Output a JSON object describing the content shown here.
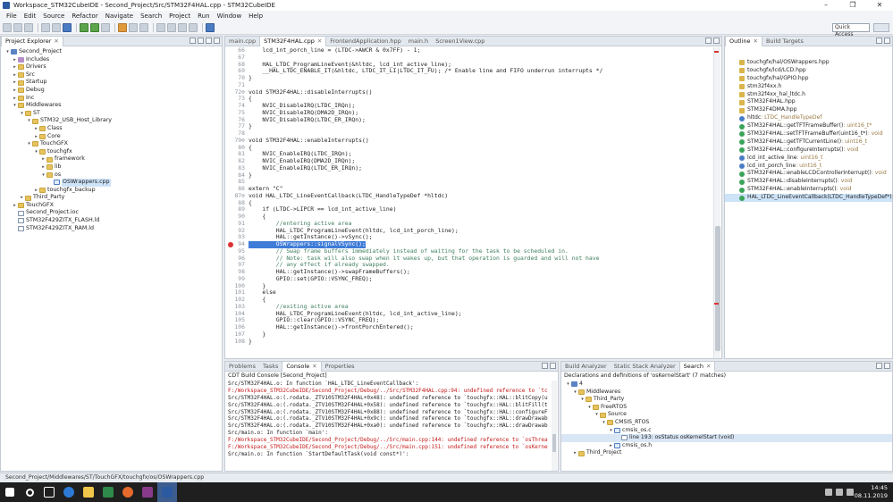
{
  "window": {
    "title": "Workspace_STM32CubeIDE - Second_Project/Src/STM32F4HAL.cpp - STM32CubeIDE",
    "controls": [
      "–",
      "❐",
      "✕"
    ]
  },
  "menu": [
    "File",
    "Edit",
    "Source",
    "Refactor",
    "Navigate",
    "Search",
    "Project",
    "Run",
    "Window",
    "Help"
  ],
  "toolbar": {
    "quick_access": "Quick Access"
  },
  "project_explorer": {
    "tab_label": "Project Explorer",
    "items": [
      {
        "label": "Second_Project",
        "depth": 0,
        "arrow": "▾",
        "icon": "proj"
      },
      {
        "label": "Includes",
        "depth": 1,
        "arrow": "▸",
        "icon": "lib"
      },
      {
        "label": "Drivers",
        "depth": 1,
        "arrow": "▸",
        "icon": "folder"
      },
      {
        "label": "Src",
        "depth": 1,
        "arrow": "▸",
        "icon": "folder"
      },
      {
        "label": "Startup",
        "depth": 1,
        "arrow": "▸",
        "icon": "folder"
      },
      {
        "label": "Debug",
        "depth": 1,
        "arrow": "▸",
        "icon": "folder"
      },
      {
        "label": "Inc",
        "depth": 1,
        "arrow": "▸",
        "icon": "folder"
      },
      {
        "label": "Middlewares",
        "depth": 1,
        "arrow": "▾",
        "icon": "folder"
      },
      {
        "label": "ST",
        "depth": 2,
        "arrow": "▾",
        "icon": "folder"
      },
      {
        "label": "STM32_USB_Host_Library",
        "depth": 3,
        "arrow": "▾",
        "icon": "folder"
      },
      {
        "label": "Class",
        "depth": 4,
        "arrow": "▸",
        "icon": "folder"
      },
      {
        "label": "Core",
        "depth": 4,
        "arrow": "▸",
        "icon": "folder"
      },
      {
        "label": "TouchGFX",
        "depth": 3,
        "arrow": "▾",
        "icon": "folder"
      },
      {
        "label": "touchgfx",
        "depth": 4,
        "arrow": "▾",
        "icon": "folder"
      },
      {
        "label": "framework",
        "depth": 5,
        "arrow": "▸",
        "icon": "folder"
      },
      {
        "label": "lib",
        "depth": 5,
        "arrow": "▸",
        "icon": "folder"
      },
      {
        "label": "os",
        "depth": 5,
        "arrow": "▾",
        "icon": "folder"
      },
      {
        "label": "OSWrappers.cpp",
        "depth": 6,
        "arrow": "",
        "icon": "cfile",
        "selected": true
      },
      {
        "label": "touchgfx_backup",
        "depth": 4,
        "arrow": "▸",
        "icon": "folder"
      },
      {
        "label": "Third_Party",
        "depth": 2,
        "arrow": "▸",
        "icon": "folder"
      },
      {
        "label": "TouchGFX",
        "depth": 1,
        "arrow": "▸",
        "icon": "folder"
      },
      {
        "label": "Second_Project.ioc",
        "depth": 1,
        "arrow": "",
        "icon": "file"
      },
      {
        "label": "STM32F429ZITX_FLASH.ld",
        "depth": 1,
        "arrow": "",
        "icon": "file"
      },
      {
        "label": "STM32F429ZITX_RAM.ld",
        "depth": 1,
        "arrow": "",
        "icon": "file"
      }
    ]
  },
  "editor": {
    "tabs": [
      {
        "label": "main.cpp",
        "active": false
      },
      {
        "label": "STM32F4HAL.cpp",
        "active": true
      },
      {
        "label": "FrontendApplication.hpp",
        "active": false
      },
      {
        "label": "main.h",
        "active": false
      },
      {
        "label": "Screen1View.cpp",
        "active": false
      }
    ],
    "lines": [
      {
        "n": "66",
        "t": "    lcd_int_porch_line = (LTDC->AWCR & 0x7FF) - 1;"
      },
      {
        "n": "67",
        "t": ""
      },
      {
        "n": "68",
        "t": "    HAL_LTDC_ProgramLineEvent(&hltdc, lcd_int_active_line);"
      },
      {
        "n": "69",
        "t": "    __HAL_LTDC_ENABLE_IT(&hltdc, LTDC_IT_LI|LTDC_IT_FU); /* Enable line and FIFO underrun interrupts */"
      },
      {
        "n": "70",
        "t": "}"
      },
      {
        "n": "71",
        "t": ""
      },
      {
        "n": "72⊖",
        "t": "void STM32F4HAL::disableInterrupts()"
      },
      {
        "n": "73",
        "t": "{"
      },
      {
        "n": "74",
        "t": "    NVIC_DisableIRQ(LTDC_IRQn);"
      },
      {
        "n": "75",
        "t": "    NVIC_DisableIRQ(DMA2D_IRQn);"
      },
      {
        "n": "76",
        "t": "    NVIC_DisableIRQ(LTDC_ER_IRQn);"
      },
      {
        "n": "77",
        "t": "}"
      },
      {
        "n": "78",
        "t": ""
      },
      {
        "n": "79⊖",
        "t": "void STM32F4HAL::enableInterrupts()"
      },
      {
        "n": "80",
        "t": "{"
      },
      {
        "n": "81",
        "t": "    NVIC_EnableIRQ(LTDC_IRQn);"
      },
      {
        "n": "82",
        "t": "    NVIC_EnableIRQ(DMA2D_IRQn);"
      },
      {
        "n": "83",
        "t": "    NVIC_EnableIRQ(LTDC_ER_IRQn);"
      },
      {
        "n": "84",
        "t": "}"
      },
      {
        "n": "85",
        "t": ""
      },
      {
        "n": "86",
        "t": "extern \"C\""
      },
      {
        "n": "87⊖",
        "t": "void HAL_LTDC_LineEventCallback(LTDC_HandleTypeDef *hltdc)"
      },
      {
        "n": "88",
        "t": "{"
      },
      {
        "n": "89",
        "t": "    if (LTDC->LIPCR == lcd_int_active_line)"
      },
      {
        "n": "90",
        "t": "    {"
      },
      {
        "n": "91",
        "t": "        //entering active area"
      },
      {
        "n": "92",
        "t": "        HAL_LTDC_ProgramLineEvent(hltdc, lcd_int_porch_line);"
      },
      {
        "n": "93",
        "t": "        HAL::getInstance()->vSync();"
      },
      {
        "n": "94",
        "t": "        OSWrappers::signalVSync();",
        "error": true
      },
      {
        "n": "95",
        "t": "        // Swap frame buffers immediately instead of waiting for the task to be scheduled in."
      },
      {
        "n": "96",
        "t": "        // Note: task will also swap when it wakes up, but that operation is guarded and will not have"
      },
      {
        "n": "97",
        "t": "        // any effect if already swapped."
      },
      {
        "n": "98",
        "t": "        HAL::getInstance()->swapFrameBuffers();"
      },
      {
        "n": "99",
        "t": "        GPIO::set(GPIO::VSYNC_FREQ);"
      },
      {
        "n": "100",
        "t": "    }"
      },
      {
        "n": "101",
        "t": "    else"
      },
      {
        "n": "102",
        "t": "    {"
      },
      {
        "n": "103",
        "t": "        //exiting active area"
      },
      {
        "n": "104",
        "t": "        HAL_LTDC_ProgramLineEvent(hltdc, lcd_int_active_line);"
      },
      {
        "n": "105",
        "t": "        GPIO::clear(GPIO::VSYNC_FREQ);"
      },
      {
        "n": "106",
        "t": "        HAL::getInstance()->frontPorchEntered();"
      },
      {
        "n": "107",
        "t": "    }"
      },
      {
        "n": "108",
        "t": "}"
      }
    ]
  },
  "outline": {
    "tabs": [
      {
        "label": "Outline",
        "active": true
      },
      {
        "label": "Build Targets",
        "active": false
      }
    ],
    "items": [
      {
        "label": "touchgfx/hal/OSWrappers.hpp",
        "type": "",
        "icon": "inc"
      },
      {
        "label": "touchgfx/lcd/LCD.hpp",
        "type": "",
        "icon": "inc"
      },
      {
        "label": "touchgfx/hal/GPIO.hpp",
        "type": "",
        "icon": "inc"
      },
      {
        "label": "stm32f4xx.h",
        "type": "",
        "icon": "inc"
      },
      {
        "label": "stm32f4xx_hal_ltdc.h",
        "type": "",
        "icon": "inc"
      },
      {
        "label": "STM32F4HAL.hpp",
        "type": "",
        "icon": "inc"
      },
      {
        "label": "STM32F4DMA.hpp",
        "type": "",
        "icon": "inc"
      },
      {
        "label": "hltdc",
        "type": " : LTDC_HandleTypeDef",
        "icon": "var"
      },
      {
        "label": "STM32F4HAL::getTFTFrameBuffer()",
        "type": " : uint16_t*",
        "icon": "fn"
      },
      {
        "label": "STM32F4HAL::setTFTFrameBuffer(uint16_t*)",
        "type": " : void",
        "icon": "fn"
      },
      {
        "label": "STM32F4HAL::getTFTCurrentLine()",
        "type": " : uint16_t",
        "icon": "fn"
      },
      {
        "label": "STM32F4HAL::configureInterrupts()",
        "type": " : void",
        "icon": "fn"
      },
      {
        "label": "lcd_int_active_line",
        "type": " : uint16_t",
        "icon": "var"
      },
      {
        "label": "lcd_int_porch_line",
        "type": " : uint16_t",
        "icon": "var"
      },
      {
        "label": "STM32F4HAL::enableLCDControllerInterrupt()",
        "type": " : void",
        "icon": "fn"
      },
      {
        "label": "STM32F4HAL::disableInterrupts()",
        "type": " : void",
        "icon": "fn"
      },
      {
        "label": "STM32F4HAL::enableInterrupts()",
        "type": " : void",
        "icon": "fn"
      },
      {
        "label": "HAL_LTDC_LineEventCallback(LTDC_HandleTypeDef*)",
        "type": " : v",
        "icon": "fn",
        "selected": true
      }
    ]
  },
  "console": {
    "tabs": [
      {
        "label": "Problems",
        "active": false
      },
      {
        "label": "Tasks",
        "active": false
      },
      {
        "label": "Console",
        "active": true
      },
      {
        "label": "Properties",
        "active": false
      }
    ],
    "title": "CDT Build Console [Second_Project]",
    "lines": [
      {
        "t": "Src/STM32F4HAL.o: In function `HAL_LTDC_LineEventCallback':",
        "err": false
      },
      {
        "t": "F:/Workspace_STM32CubeIDE/Second_Project/Debug/../Src/STM32F4HAL.cpp:94: undefined reference to `tc",
        "err": true
      },
      {
        "t": "Src/STM32F4HAL.o:(.rodata._ZTV10STM32F4HAL+0x48): undefined reference to `touchgfx::HAL::blitCopy(u",
        "err": false
      },
      {
        "t": "Src/STM32F4HAL.o:(.rodata._ZTV10STM32F4HAL+0x58): undefined reference to `touchgfx::HAL::blitFill(t",
        "err": false
      },
      {
        "t": "Src/STM32F4HAL.o:(.rodata._ZTV10STM32F4HAL+0x88): undefined reference to `touchgfx::HAL::configureF",
        "err": false
      },
      {
        "t": "Src/STM32F4HAL.o:(.rodata._ZTV10STM32F4HAL+0x9c): undefined reference to `touchgfx::HAL::drawDrawab",
        "err": false
      },
      {
        "t": "Src/STM32F4HAL.o:(.rodata._ZTV10STM32F4HAL+0xa0): undefined reference to `touchgfx::HAL::drawDrawab",
        "err": false
      },
      {
        "t": "Src/main.o: In function `main':",
        "err": false
      },
      {
        "t": "F:/Workspace_STM32CubeIDE/Second_Project/Debug/../Src/main.cpp:144: undefined reference to `osThrea",
        "err": true
      },
      {
        "t": "F:/Workspace_STM32CubeIDE/Second_Project/Debug/../Src/main.cpp:151: undefined reference to `osKerne",
        "err": true
      },
      {
        "t": "Src/main.o: In function `StartDefaultTask(void const*)':",
        "err": false
      }
    ]
  },
  "search": {
    "tabs": [
      {
        "label": "Build Analyzer",
        "active": false
      },
      {
        "label": "Static Stack Analyzer",
        "active": false
      },
      {
        "label": "Search",
        "active": true
      }
    ],
    "title": "Declarations and definitions of 'osKernelStart' (7 matches)",
    "items": [
      {
        "label": "4",
        "depth": 0,
        "arrow": "▾",
        "icon": "proj"
      },
      {
        "label": "Middlewares",
        "depth": 1,
        "arrow": "▾",
        "icon": "folder"
      },
      {
        "label": "Third_Party",
        "depth": 2,
        "arrow": "▾",
        "icon": "folder"
      },
      {
        "label": "FreeRTOS",
        "depth": 3,
        "arrow": "▾",
        "icon": "folder"
      },
      {
        "label": "Source",
        "depth": 4,
        "arrow": "▾",
        "icon": "folder"
      },
      {
        "label": "CMSIS_RTOS",
        "depth": 5,
        "arrow": "▾",
        "icon": "folder"
      },
      {
        "label": "cmsis_os.c",
        "depth": 6,
        "arrow": "▾",
        "icon": "cfile"
      },
      {
        "label": "line 193: osStatus osKernelStart (void)",
        "depth": 7,
        "arrow": "",
        "icon": "file",
        "selected": true
      },
      {
        "label": "cmsis_os.h",
        "depth": 6,
        "arrow": "▸",
        "icon": "cfile"
      },
      {
        "label": "Third_Project",
        "depth": 1,
        "arrow": "▸",
        "icon": "folder"
      }
    ]
  },
  "status": {
    "path": "Second_Project/Middlewares/ST/TouchGFX/touchgfx/os/OSWrappers.cpp"
  },
  "taskbar": {
    "time": "14:45",
    "date": "08.11.2019"
  }
}
